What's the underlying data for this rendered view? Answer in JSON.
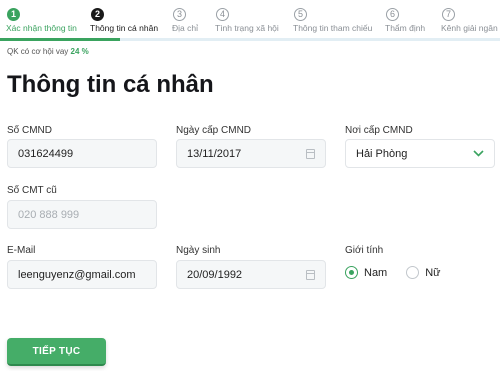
{
  "colors": {
    "accent": "#3aa35f",
    "active_step": "#1a1a1a",
    "inactive_step": "#8a8f95",
    "track": "#e2eef4"
  },
  "steps": [
    {
      "number": "1",
      "label": "Xác nhận thông tin",
      "state": "done"
    },
    {
      "number": "2",
      "label": "Thông tin cá nhân",
      "state": "active"
    },
    {
      "number": "3",
      "label": "Địa chỉ",
      "state": "upcoming"
    },
    {
      "number": "4",
      "label": "Tình trạng xã hội",
      "state": "upcoming"
    },
    {
      "number": "5",
      "label": "Thông tin tham chiếu",
      "state": "upcoming"
    },
    {
      "number": "6",
      "label": "Thẩm định",
      "state": "upcoming"
    },
    {
      "number": "7",
      "label": "Kênh giải ngân",
      "state": "upcoming"
    }
  ],
  "progress": {
    "text": "QK có cơ hội vay",
    "percent_label": "24 %",
    "fraction": 0.24
  },
  "page_title": "Thông tin cá nhân",
  "form": {
    "id_number": {
      "label": "Số CMND",
      "value": "031624499"
    },
    "issue_date": {
      "label": "Ngày cấp CMND",
      "value": "13/11/2017"
    },
    "issue_place": {
      "label": "Nơi cấp CMND",
      "value": "Hải Phòng"
    },
    "old_id": {
      "label": "Số CMT cũ",
      "placeholder": "020 888 999"
    },
    "email": {
      "label": "E-Mail",
      "value": "leenguyenz@gmail.com"
    },
    "birth_date": {
      "label": "Ngày sinh",
      "value": "20/09/1992"
    },
    "gender": {
      "label": "Giới tính",
      "options": [
        "Nam",
        "Nữ"
      ],
      "selected": "Nam"
    }
  },
  "continue_button": "TIẾP TỤC",
  "icons": {
    "calendar": "calendar-icon",
    "dropdown": "chevron-down-icon"
  }
}
